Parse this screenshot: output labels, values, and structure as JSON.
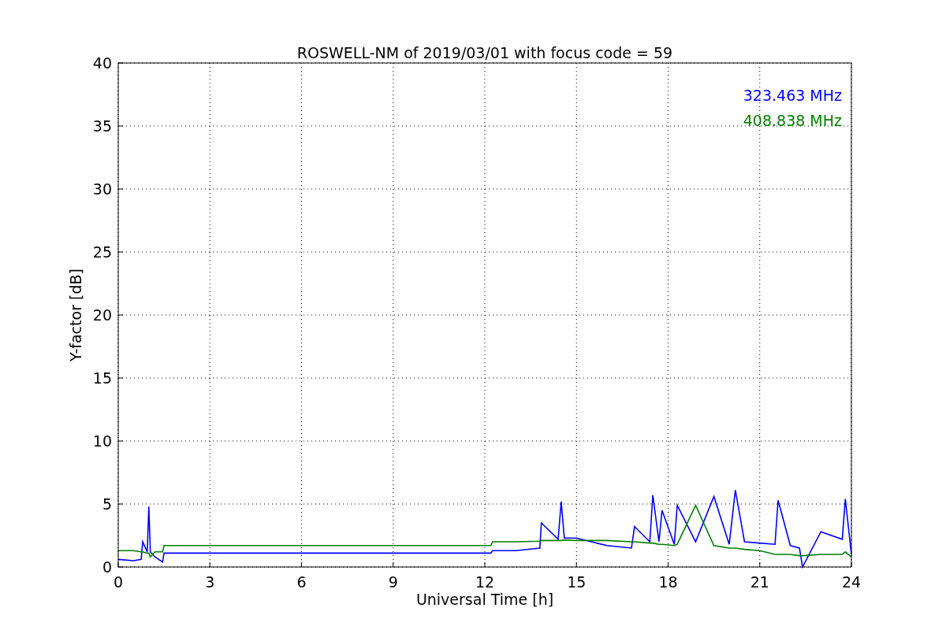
{
  "chart_data": {
    "type": "line",
    "title": "ROSWELL-NM of 2019/03/01 with focus code = 59",
    "xlabel": "Universal Time [h]",
    "ylabel": "Y-factor [dB]",
    "x": [
      0,
      0.5,
      0.75,
      0.8,
      0.95,
      1.0,
      1.05,
      1.2,
      1.45,
      1.5,
      3,
      6,
      9,
      12.2,
      12.25,
      13,
      13.8,
      13.85,
      14.4,
      14.5,
      14.6,
      15,
      16,
      16.8,
      16.9,
      17.4,
      17.5,
      17.7,
      17.8,
      18.2,
      18.3,
      18.9,
      19.5,
      20,
      20.2,
      20.5,
      21,
      21.5,
      21.6,
      22,
      22.3,
      22.4,
      23,
      23.7,
      23.8,
      24
    ],
    "series": [
      {
        "name": "323.463 MHz",
        "color": "#0000ff",
        "values": [
          0.6,
          0.5,
          0.6,
          2.0,
          1.2,
          4.8,
          1.2,
          0.8,
          0.4,
          1.1,
          1.1,
          1.1,
          1.1,
          1.1,
          1.3,
          1.3,
          1.5,
          3.5,
          2.2,
          5.2,
          2.3,
          2.3,
          1.7,
          1.5,
          3.2,
          2.0,
          5.7,
          2.0,
          4.5,
          1.8,
          4.9,
          2.0,
          5.6,
          1.8,
          6.1,
          2.0,
          1.9,
          1.8,
          5.3,
          1.7,
          1.5,
          0.0,
          2.8,
          2.2,
          5.4,
          1.0
        ]
      },
      {
        "name": "408.838 MHz",
        "color": "#008000",
        "values": [
          1.3,
          1.3,
          1.2,
          1.2,
          1.1,
          1.1,
          0.8,
          1.2,
          1.2,
          1.7,
          1.7,
          1.7,
          1.7,
          1.7,
          2.0,
          2.0,
          2.05,
          2.1,
          2.1,
          2.1,
          2.15,
          2.1,
          2.1,
          2.0,
          2.0,
          1.9,
          1.9,
          1.8,
          1.8,
          1.7,
          1.8,
          4.9,
          1.7,
          1.5,
          1.5,
          1.4,
          1.3,
          1.0,
          1.0,
          1.0,
          0.9,
          0.9,
          1.0,
          1.0,
          1.2,
          0.8
        ]
      }
    ],
    "grid": true,
    "xlim": [
      0,
      24
    ],
    "ylim": [
      0,
      40
    ],
    "xticks": [
      0,
      3,
      6,
      9,
      12,
      15,
      18,
      21,
      24
    ],
    "yticks": [
      0,
      5,
      10,
      15,
      20,
      25,
      30,
      35,
      40
    ]
  }
}
